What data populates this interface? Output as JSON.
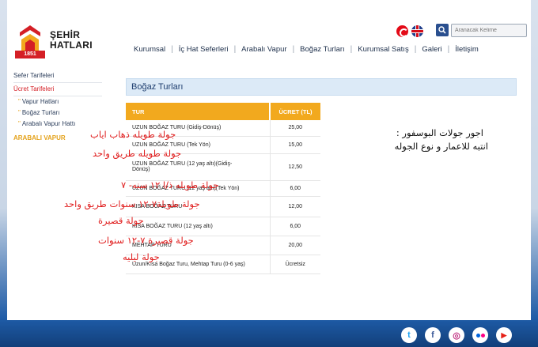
{
  "brand": {
    "line1": "ŞEHİR",
    "line2": "HATLARI",
    "year": "1851"
  },
  "search": {
    "placeholder": "Aranacak Kelime"
  },
  "nav": [
    "Kurumsal",
    "İç Hat Seferleri",
    "Arabalı Vapur",
    "Boğaz Turları",
    "Kurumsal Satış",
    "Galeri",
    "İletişim"
  ],
  "sidebar": {
    "items": [
      "Sefer Tarifeleri",
      "Ücret Tarifeleri"
    ],
    "subitems": [
      "Vapur Hatları",
      "Boğaz Turları",
      "Arabalı Vapur Hattı"
    ],
    "section": "ARABALI VAPUR"
  },
  "content": {
    "title": "Boğaz Turları",
    "table": {
      "headers": [
        "TUR",
        "ÜCRET (TL)"
      ],
      "rows": [
        {
          "tour": "UZUN BOĞAZ TURU (Gidiş-Dönüş)",
          "price": "25,00"
        },
        {
          "tour": "UZUN BOĞAZ TURU (Tek Yön)",
          "price": "15,00"
        },
        {
          "tour_l1": "UZUN BOĞAZ TURU (12 yaş altı)(Gidiş-",
          "tour_l2": "Dönüş)",
          "price": "12,50"
        },
        {
          "tour": "UZUN BOĞAZ TURU (12 yaş altı)(Tek Yön)",
          "price": "6,00"
        },
        {
          "tour": "KISA BOĞAZ TURU",
          "price": "12,00"
        },
        {
          "tour": "KISA BOĞAZ TURU (12 yaş altı)",
          "price": "6,00"
        },
        {
          "tour": "MEHTAP TURU",
          "price": "20,00"
        },
        {
          "tour": "Uzun/Kısa Boğaz Turu, Mehtap Turu (0-6 yaş)",
          "price": "Ücretsiz"
        }
      ]
    }
  },
  "annotations": {
    "note_line1": "اجور جولات البوسفور :",
    "note_line2": "انتبه للاعمار و نوع الجوله",
    "red": [
      "جولة طويله ذهاب اياب",
      "جولة طويله طريق واحد",
      "جولة طويله ذ/ا ١٢ سنه- ٧",
      "جولة طويلة٧-١٢ سنوات طريق واحد",
      "جولة قصيرة",
      "جولة قصيرة ٧-١٢ سنوات",
      "جولة ليليه"
    ]
  },
  "social": [
    "twitter-icon",
    "facebook-icon",
    "instagram-icon",
    "flickr-icon",
    "youtube-icon"
  ],
  "colors": {
    "accent": "#f2a91e",
    "brand_red": "#d41f26",
    "nav_text": "#1c2e4a",
    "annotation_red": "#e01d1d"
  }
}
